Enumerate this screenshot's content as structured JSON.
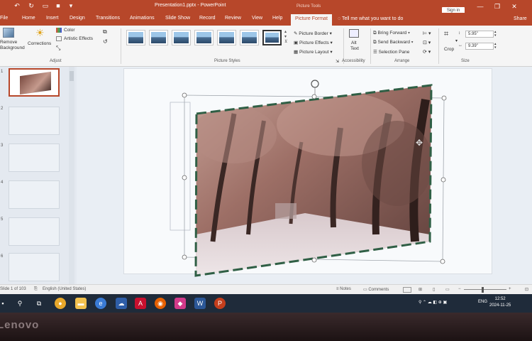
{
  "title_bar": {
    "document_title": "Presentation1.pptx - PowerPoint",
    "context_label": "Picture Tools",
    "sign_in": "Sign in",
    "qat_icons": [
      "save-icon",
      "undo-icon",
      "redo-icon",
      "present-icon",
      "customize-icon"
    ],
    "window_controls": {
      "minimize": "—",
      "restore": "❐",
      "close": "✕"
    }
  },
  "tabs": [
    "File",
    "Home",
    "Insert",
    "Design",
    "Transitions",
    "Animations",
    "Slide Show",
    "Record",
    "Review",
    "View",
    "Help",
    "Picture Format"
  ],
  "active_tab": "Picture Format",
  "tell_me": "Tell me what you want to do",
  "share": "Share",
  "ribbon": {
    "remove_background": {
      "line1": "Remove",
      "line2": "Background"
    },
    "corrections": "Corrections",
    "color": "Color",
    "artistic_effects": "Artistic Effects",
    "adjust_label": "Adjust",
    "picture_styles_label": "Picture Styles",
    "picture_border": "Picture Border",
    "picture_effects": "Picture Effects",
    "picture_layout": "Picture Layout",
    "alt_text": {
      "line1": "Alt",
      "line2": "Text"
    },
    "accessibility_label": "Accessibility",
    "bring_forward": "Bring Forward",
    "send_backward": "Send Backward",
    "selection_pane": "Selection Pane",
    "arrange_label": "Arrange",
    "crop": "Crop",
    "height": "5.95\"",
    "width": "9.39\"",
    "size_label": "Size"
  },
  "thumbnails": {
    "slide_numbers": [
      "1",
      "2",
      "3",
      "4",
      "5",
      "6"
    ],
    "selected": "1"
  },
  "status_bar": {
    "slide_info": "Slide 1 of 103",
    "language": "English (United States)",
    "notes": "Notes",
    "comments": "Comments"
  },
  "taskbar": {
    "weather": "",
    "language": "ENG",
    "time": "12:52",
    "date": "2024-11-25"
  },
  "bezel_brand": "Lenovo",
  "colors": {
    "accent": "#b7472a",
    "ribbon": "#f5f5f5",
    "taskbar": "#1f2b3a",
    "dashed_border": "#2f5f45"
  }
}
